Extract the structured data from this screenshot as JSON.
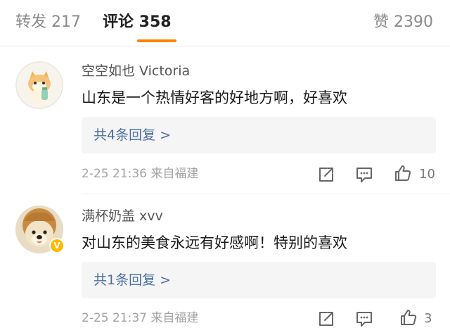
{
  "tabs": {
    "repost": "转发 217",
    "comment": "评论 358",
    "like": "赞 2390"
  },
  "accent_color": "#ff8200",
  "comments": [
    {
      "author": "空空如也 Victoria",
      "text": "山东是一个热情好客的好地方啊，好喜欢",
      "replies_label": "共4条回复 >",
      "meta": "2-25 21:36 来自福建",
      "likes": "10",
      "avatar_icon": "cat-avatar-icon"
    },
    {
      "author": "满杯奶盖 xvv",
      "text": "对山东的美食永远有好感啊！特别的喜欢",
      "replies_label": "共1条回复 >",
      "meta": "2-25 21:37 来自福建",
      "likes": "3",
      "avatar_icon": "dog-avatar-icon",
      "badge": "V"
    }
  ]
}
